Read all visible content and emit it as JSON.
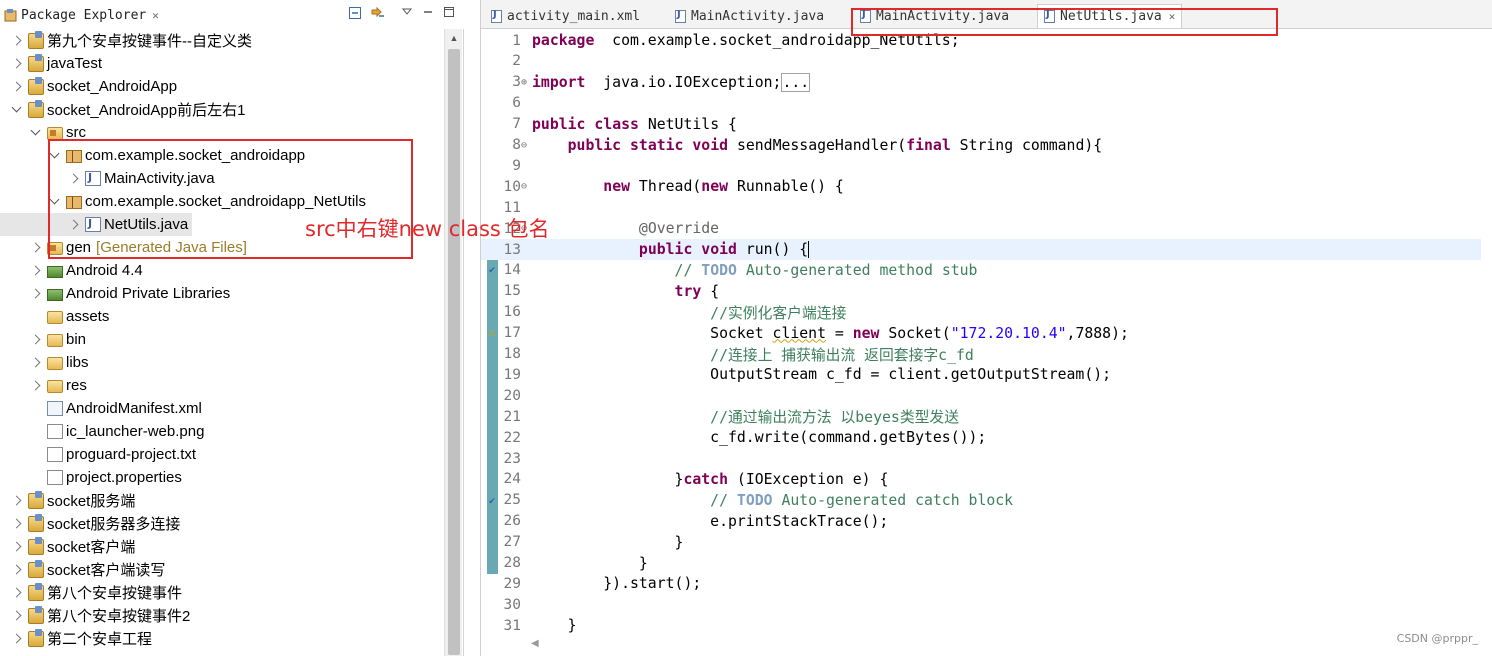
{
  "explorer": {
    "title": "Package Explorer",
    "items": [
      {
        "depth": 0,
        "twisty": "closed",
        "icon": "project",
        "label": "第九个安卓按键事件--自定义类"
      },
      {
        "depth": 0,
        "twisty": "closed",
        "icon": "project",
        "label": "javaTest"
      },
      {
        "depth": 0,
        "twisty": "closed",
        "icon": "project",
        "label": "socket_AndroidApp"
      },
      {
        "depth": 0,
        "twisty": "open",
        "icon": "project",
        "label": "socket_AndroidApp前后左右1"
      },
      {
        "depth": 1,
        "twisty": "open",
        "icon": "srcfolder",
        "label": "src"
      },
      {
        "depth": 2,
        "twisty": "open",
        "icon": "package",
        "label": "com.example.socket_androidapp"
      },
      {
        "depth": 3,
        "twisty": "closed",
        "icon": "java",
        "label": "MainActivity.java"
      },
      {
        "depth": 2,
        "twisty": "open",
        "icon": "package",
        "label": "com.example.socket_androidapp_NetUtils"
      },
      {
        "depth": 3,
        "twisty": "closed",
        "icon": "java",
        "label": "NetUtils.java",
        "selected": true
      },
      {
        "depth": 1,
        "twisty": "closed",
        "icon": "srcfolder",
        "label": "gen",
        "note": "[Generated Java Files]"
      },
      {
        "depth": 1,
        "twisty": "closed",
        "icon": "lib",
        "label": "Android 4.4"
      },
      {
        "depth": 1,
        "twisty": "closed",
        "icon": "lib",
        "label": "Android Private Libraries"
      },
      {
        "depth": 1,
        "twisty": "none",
        "icon": "folder",
        "label": "assets"
      },
      {
        "depth": 1,
        "twisty": "closed",
        "icon": "folder",
        "label": "bin"
      },
      {
        "depth": 1,
        "twisty": "closed",
        "icon": "folder",
        "label": "libs"
      },
      {
        "depth": 1,
        "twisty": "closed",
        "icon": "folder",
        "label": "res"
      },
      {
        "depth": 1,
        "twisty": "none",
        "icon": "xml",
        "label": "AndroidManifest.xml"
      },
      {
        "depth": 1,
        "twisty": "none",
        "icon": "file",
        "label": "ic_launcher-web.png"
      },
      {
        "depth": 1,
        "twisty": "none",
        "icon": "file",
        "label": "proguard-project.txt"
      },
      {
        "depth": 1,
        "twisty": "none",
        "icon": "file",
        "label": "project.properties"
      },
      {
        "depth": 0,
        "twisty": "closed",
        "icon": "project",
        "label": "socket服务端"
      },
      {
        "depth": 0,
        "twisty": "closed",
        "icon": "project",
        "label": "socket服务器多连接"
      },
      {
        "depth": 0,
        "twisty": "closed",
        "icon": "project",
        "label": "socket客户端"
      },
      {
        "depth": 0,
        "twisty": "closed",
        "icon": "project",
        "label": "socket客户端读写"
      },
      {
        "depth": 0,
        "twisty": "closed",
        "icon": "project",
        "label": "第八个安卓按键事件"
      },
      {
        "depth": 0,
        "twisty": "closed",
        "icon": "project",
        "label": "第八个安卓按键事件2"
      },
      {
        "depth": 0,
        "twisty": "closed",
        "icon": "project",
        "label": "第二个安卓工程"
      }
    ]
  },
  "editor": {
    "tabs": [
      {
        "label": "activity_main.xml",
        "active": false
      },
      {
        "label": "MainActivity.java",
        "active": false
      },
      {
        "label": "MainActivity.java",
        "active": false
      },
      {
        "label": "NetUtils.java",
        "active": true
      }
    ],
    "lines": [
      {
        "n": "1",
        "tokens": [
          [
            "kw",
            "package"
          ],
          [
            "",
            "  com.example.socket_androidapp_NetUtils;"
          ]
        ]
      },
      {
        "n": "2",
        "tokens": []
      },
      {
        "n": "3",
        "fold": "⊕",
        "tokens": [
          [
            "kw",
            "import"
          ],
          [
            "",
            "  java.io.IOException;"
          ],
          [
            "box",
            "..."
          ]
        ]
      },
      {
        "n": "6",
        "tokens": []
      },
      {
        "n": "7",
        "tokens": [
          [
            "kw",
            "public"
          ],
          [
            "",
            " "
          ],
          [
            "kw",
            "class"
          ],
          [
            "",
            " NetUtils {"
          ]
        ]
      },
      {
        "n": "8",
        "fold": "⊖",
        "tokens": [
          [
            "",
            "    "
          ],
          [
            "kw",
            "public"
          ],
          [
            "",
            " "
          ],
          [
            "kw",
            "static"
          ],
          [
            "",
            " "
          ],
          [
            "kw",
            "void"
          ],
          [
            "",
            " sendMessageHandler("
          ],
          [
            "kw",
            "final"
          ],
          [
            "",
            " String command){"
          ]
        ]
      },
      {
        "n": "9",
        "tokens": []
      },
      {
        "n": "10",
        "fold": "⊖",
        "tokens": [
          [
            "",
            "        "
          ],
          [
            "kw",
            "new"
          ],
          [
            "",
            " Thread("
          ],
          [
            "kw",
            "new"
          ],
          [
            "",
            " Runnable() {"
          ]
        ]
      },
      {
        "n": "11",
        "tokens": []
      },
      {
        "n": "12",
        "fold": "⊖",
        "tokens": [
          [
            "",
            "            "
          ],
          [
            "an",
            "@Override"
          ]
        ]
      },
      {
        "n": "13",
        "cur": true,
        "tokens": [
          [
            "",
            "            "
          ],
          [
            "kw",
            "public"
          ],
          [
            "",
            " "
          ],
          [
            "kw",
            "void"
          ],
          [
            "",
            " run() {"
          ],
          [
            "caret",
            ""
          ]
        ]
      },
      {
        "n": "14",
        "tokens": [
          [
            "",
            "                "
          ],
          [
            "cm",
            "// "
          ],
          [
            "td",
            "TODO"
          ],
          [
            "cm",
            " Auto-generated method stub"
          ]
        ]
      },
      {
        "n": "15",
        "tokens": [
          [
            "",
            "                "
          ],
          [
            "kw",
            "try"
          ],
          [
            "",
            " {"
          ]
        ]
      },
      {
        "n": "16",
        "tokens": [
          [
            "",
            "                    "
          ],
          [
            "cm",
            "//实例化客户端连接"
          ]
        ]
      },
      {
        "n": "17",
        "tokens": [
          [
            "",
            "                    Socket "
          ],
          [
            "sq",
            "client"
          ],
          [
            "",
            " = "
          ],
          [
            "kw",
            "new"
          ],
          [
            "",
            " Socket("
          ],
          [
            "st",
            "\"172.20.10.4\""
          ],
          [
            "",
            ",7888);"
          ]
        ]
      },
      {
        "n": "18",
        "tokens": [
          [
            "",
            "                    "
          ],
          [
            "cm",
            "//连接上 捕获输出流 返回套接字c_fd"
          ]
        ]
      },
      {
        "n": "19",
        "tokens": [
          [
            "",
            "                    OutputStream c_fd = client.getOutputStream();"
          ]
        ]
      },
      {
        "n": "20",
        "tokens": []
      },
      {
        "n": "21",
        "tokens": [
          [
            "",
            "                    "
          ],
          [
            "cm",
            "//通过输出流方法 以beyes类型发送"
          ]
        ]
      },
      {
        "n": "22",
        "tokens": [
          [
            "",
            "                    c_fd.write(command.getBytes());"
          ]
        ]
      },
      {
        "n": "23",
        "tokens": []
      },
      {
        "n": "24",
        "tokens": [
          [
            "",
            "                }"
          ],
          [
            "kw",
            "catch"
          ],
          [
            "",
            " (IOException e) {"
          ]
        ]
      },
      {
        "n": "25",
        "tokens": [
          [
            "",
            "                    "
          ],
          [
            "cm",
            "// "
          ],
          [
            "td",
            "TODO"
          ],
          [
            "cm",
            " Auto-generated catch block"
          ]
        ]
      },
      {
        "n": "26",
        "tokens": [
          [
            "",
            "                    e.printStackTrace();"
          ]
        ]
      },
      {
        "n": "27",
        "tokens": [
          [
            "",
            "                }"
          ]
        ]
      },
      {
        "n": "28",
        "tokens": [
          [
            "",
            "            }"
          ]
        ]
      },
      {
        "n": "29",
        "tokens": [
          [
            "",
            "        }).start();"
          ]
        ]
      },
      {
        "n": "30",
        "tokens": []
      },
      {
        "n": "31",
        "tokens": [
          [
            "",
            "    }"
          ]
        ]
      }
    ]
  },
  "annotation": {
    "note": "src中右键new class 包名"
  },
  "watermark": "CSDN @prppr_"
}
